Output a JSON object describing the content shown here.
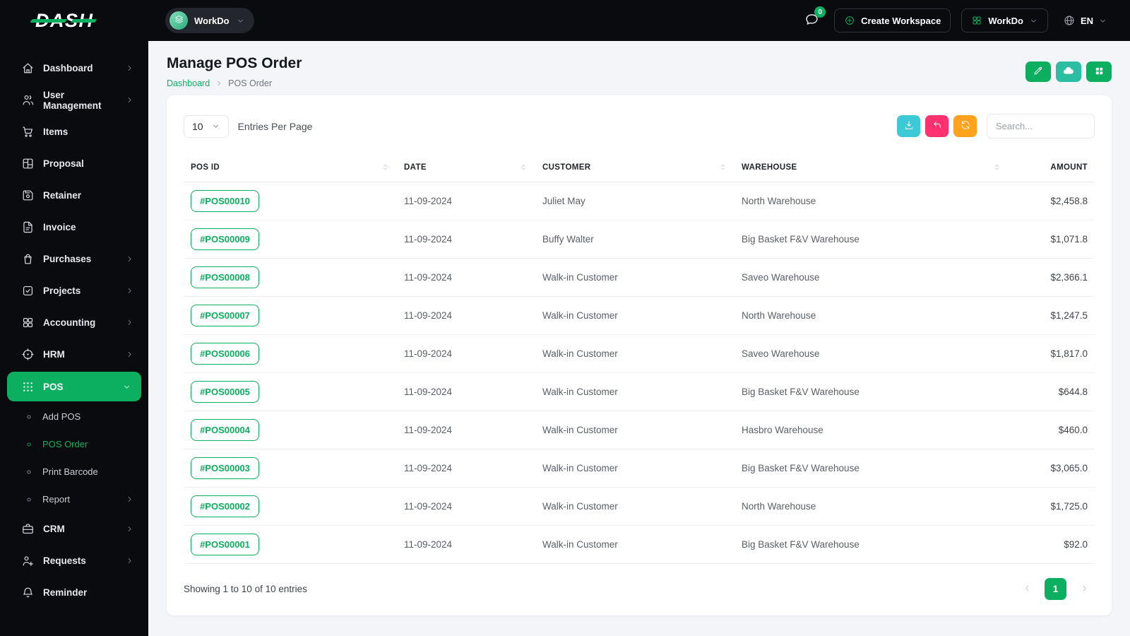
{
  "brand": {
    "logo": "DASH"
  },
  "topbar": {
    "workspace_pill_label": "WorkDo",
    "chat_badge": "0",
    "create_workspace_label": "Create Workspace",
    "workspace_menu_label": "WorkDo",
    "language_label": "EN"
  },
  "sidebar": {
    "items": [
      {
        "label": "Dashboard",
        "icon": "home-icon",
        "chevron": "right"
      },
      {
        "label": "User Management",
        "icon": "users-icon",
        "chevron": "right"
      },
      {
        "label": "Items",
        "icon": "shopping-cart-icon"
      },
      {
        "label": "Proposal",
        "icon": "layout-board-icon"
      },
      {
        "label": "Retainer",
        "icon": "device-floppy-icon"
      },
      {
        "label": "Invoice",
        "icon": "file-invoice-icon"
      },
      {
        "label": "Purchases",
        "icon": "shopping-bag-icon",
        "chevron": "right"
      },
      {
        "label": "Projects",
        "icon": "checkbox-icon",
        "chevron": "right"
      },
      {
        "label": "Accounting",
        "icon": "layout-grid-icon",
        "chevron": "right"
      },
      {
        "label": "HRM",
        "icon": "focus-icon",
        "chevron": "right"
      },
      {
        "label": "POS",
        "icon": "grid-dots-icon",
        "chevron": "down",
        "active": true
      },
      {
        "label": "Add POS",
        "icon": "point-icon",
        "sub": true
      },
      {
        "label": "POS Order",
        "icon": "point-icon",
        "sub": true,
        "current": true
      },
      {
        "label": "Print Barcode",
        "icon": "point-icon",
        "sub": true
      },
      {
        "label": "Report",
        "icon": "point-icon",
        "sub": true,
        "chevron": "right"
      },
      {
        "label": "CRM",
        "icon": "briefcase-icon",
        "chevron": "right"
      },
      {
        "label": "Requests",
        "icon": "user-plus-icon",
        "chevron": "right"
      },
      {
        "label": "Reminder",
        "icon": "bell-icon"
      }
    ]
  },
  "page": {
    "title": "Manage POS Order",
    "breadcrumb_home": "Dashboard",
    "breadcrumb_current": "POS Order"
  },
  "card": {
    "entries_per_page_value": "10",
    "entries_per_page_label": "Entries Per Page",
    "search_placeholder": "Search...",
    "table": {
      "columns": [
        "POS ID",
        "DATE",
        "CUSTOMER",
        "WAREHOUSE",
        "AMOUNT"
      ],
      "rows": [
        {
          "pos_id": "#POS00010",
          "date": "11-09-2024",
          "customer": "Juliet May",
          "warehouse": "North Warehouse",
          "amount": "$2,458.8"
        },
        {
          "pos_id": "#POS00009",
          "date": "11-09-2024",
          "customer": "Buffy Walter",
          "warehouse": "Big Basket F&V Warehouse",
          "amount": "$1,071.8"
        },
        {
          "pos_id": "#POS00008",
          "date": "11-09-2024",
          "customer": "Walk-in Customer",
          "warehouse": "Saveo Warehouse",
          "amount": "$2,366.1"
        },
        {
          "pos_id": "#POS00007",
          "date": "11-09-2024",
          "customer": "Walk-in Customer",
          "warehouse": "North Warehouse",
          "amount": "$1,247.5"
        },
        {
          "pos_id": "#POS00006",
          "date": "11-09-2024",
          "customer": "Walk-in Customer",
          "warehouse": "Saveo Warehouse",
          "amount": "$1,817.0"
        },
        {
          "pos_id": "#POS00005",
          "date": "11-09-2024",
          "customer": "Walk-in Customer",
          "warehouse": "Big Basket F&V Warehouse",
          "amount": "$644.8"
        },
        {
          "pos_id": "#POS00004",
          "date": "11-09-2024",
          "customer": "Walk-in Customer",
          "warehouse": "Hasbro Warehouse",
          "amount": "$460.0"
        },
        {
          "pos_id": "#POS00003",
          "date": "11-09-2024",
          "customer": "Walk-in Customer",
          "warehouse": "Big Basket F&V Warehouse",
          "amount": "$3,065.0"
        },
        {
          "pos_id": "#POS00002",
          "date": "11-09-2024",
          "customer": "Walk-in Customer",
          "warehouse": "North Warehouse",
          "amount": "$1,725.0"
        },
        {
          "pos_id": "#POS00001",
          "date": "11-09-2024",
          "customer": "Walk-in Customer",
          "warehouse": "Big Basket F&V Warehouse",
          "amount": "$92.0"
        }
      ]
    },
    "footer": {
      "showing_text": "Showing 1 to 10 of 10 entries",
      "current_page": "1"
    }
  },
  "colors": {
    "primary_green": "#0CAF60",
    "info_teal": "#3EC9D6",
    "danger_pink": "#FF316F",
    "warning_orange": "#FFA21D",
    "cloud_button": "#2DBDA2"
  }
}
